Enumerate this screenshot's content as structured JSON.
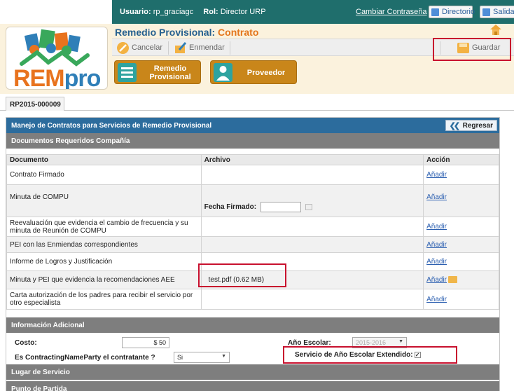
{
  "top_bar": {
    "user_label": "Usuario:",
    "user_value": "rp_graciagc",
    "role_label": "Rol:",
    "role_value": "Director URP",
    "change_password_link": "Cambiar Contraseña",
    "directory_button": "Directorio",
    "exit_button": "Salida"
  },
  "logo": {
    "part1": "REM",
    "part2": "pro"
  },
  "header": {
    "title_prefix": "Remedio Provisional:",
    "title_suffix": "Contrato"
  },
  "actions": {
    "cancel": "Cancelar",
    "amend": "Enmendar",
    "save": "Guardar"
  },
  "nav_tiles": [
    {
      "line1": "Remedio",
      "line2": "Provisional"
    },
    {
      "line1": "Proveedor",
      "line2": ""
    }
  ],
  "tab": {
    "label": "RP2015-000009"
  },
  "panel": {
    "title": "Manejo de Contratos para Servicios de Remedio Provisional",
    "back_button": "Regresar",
    "documents_section": "Documentos Requeridos Compañía",
    "columns": [
      "Documento",
      "Archivo",
      "Acción"
    ],
    "rows": [
      {
        "document": "Contrato Firmado",
        "file": "",
        "action": "Añadir"
      },
      {
        "document": "Minuta de COMPU",
        "file": "",
        "action": "Añadir"
      },
      {
        "document": "Reevaluación que evidencia el cambio de frecuencia y su minuta de Reunión de COMPU",
        "file": "",
        "action": "Añadir"
      },
      {
        "document": "PEI con las Enmiendas correspondientes",
        "file": "",
        "action": "Añadir"
      },
      {
        "document": "Informe de Logros y Justificación",
        "file": "",
        "action": "Añadir"
      },
      {
        "document": "Minuta y PEI que evidencia la recomendaciones AEE",
        "file": "test.pdf (0.62 MB)",
        "action": "Añadir"
      },
      {
        "document": "Carta autorización de los padres para recibir el servicio por otro especialista",
        "file": "",
        "action": "Añadir"
      }
    ],
    "date_signed_label": "Fecha Firmado:",
    "date_signed_value": "",
    "additional_section": "Información Adicional",
    "cost_label": "Costo:",
    "cost_value": "$ 50",
    "school_year_label": "Año Escolar:",
    "school_year_value": "2015-2016",
    "contracting_label": "Es ContractingNameParty el contratante ?",
    "contracting_value": "Si",
    "extended_label": "Servicio de Año Escolar Extendido:",
    "extended_checked": true,
    "service_place_section": "Lugar de Servicio",
    "starting_point_section": "Punto de Partida"
  },
  "colors": {
    "teal_bar": "#1f6e6c",
    "header_bg": "#fbf2dd",
    "panel_blue": "#2c6c9d",
    "section_gray": "#7e7e7e",
    "tile_orange": "#c9861a",
    "annotation_red": "#c8102e",
    "link_blue": "#2b5fb0"
  }
}
